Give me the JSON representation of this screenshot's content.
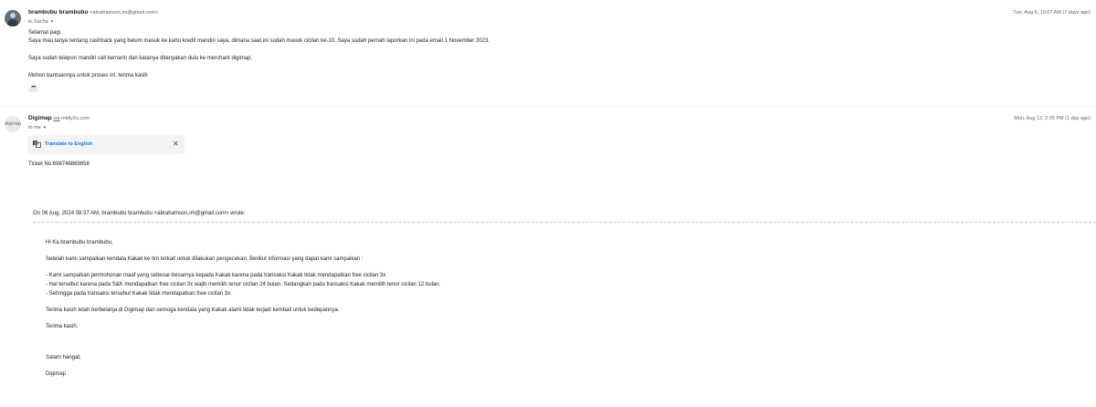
{
  "message1": {
    "sender_name": "brambubu brambubu",
    "sender_email": "<abrahamson.im@gmail.com>",
    "to_label": "to Sacha",
    "date": "Tue, Aug 6, 10:07 AM (7 days ago)",
    "body": [
      "Selamat pagi,",
      "Saya mau tanya tentang cashback yang belum masuk ke kartu kredit mandiri saya, dimana saat ini sudah masuk cicilan ke-10. Saya sudah pernah laporkan ini pada email 1 November 2023.",
      "Saya sudah telepon mandiri call kemarin dan katanya ditanyakan dulu ke merchant digimap.",
      "Mohon bantuannya untuk proses ini, terima kasih"
    ],
    "ellipsis": "•••"
  },
  "message2": {
    "avatar_text": "digimap",
    "sender_name": "Digimap",
    "via_label": "via",
    "via_domain": "mktly2u.com",
    "to_label": "to me",
    "date": "Mon, Aug 12, 2:25 PM (1 day ago)",
    "translate_label": "Translate to English",
    "close_glyph": "✕",
    "ticket": "Ticket No:698746869858",
    "quote_header": "On 06 Aug, 2024 08:37 AM, brambubu brambubu <abrahamson.im@gmail.com> wrote:",
    "quoted_body": [
      "Hi Ka brambubu brambubu,",
      "Setelah kami sampaikan kendala Kakak ke tim terkait untuk dilakukan pengecekan. Berikut informasi yang dapat kami sampaikan :",
      "- Kami sampaikan permohonan maaf yang sebesar-besarnya kepada Kakak karena pada transaksi Kakak tidak mendapatkan free cicilan 3x.",
      "- Hal tersebut karena pada S&K mendapatkan free cicilan 3x wajib memilih tenor cicilan 24 bulan. Sedangkan pada transaksi Kakak memilih tenor cicilan 12 bulan.",
      "- Sehingga pada transaksi tersebut Kakak tidak mendapatkan free cicilan 3x.",
      "Terima kasih telah berbelanja di Digimap dan semoga kendala yang Kakak alami tidak terjadi kembali untuk kedepannya.",
      "Terima kasih.",
      "Salam hangat,",
      "Digimap"
    ]
  },
  "icons": {
    "translate": "translate-icon",
    "caret": "chevron-down-icon",
    "close": "close-icon"
  },
  "colors": {
    "link": "#1a73e8",
    "muted": "#5f6368",
    "text": "#202124"
  }
}
